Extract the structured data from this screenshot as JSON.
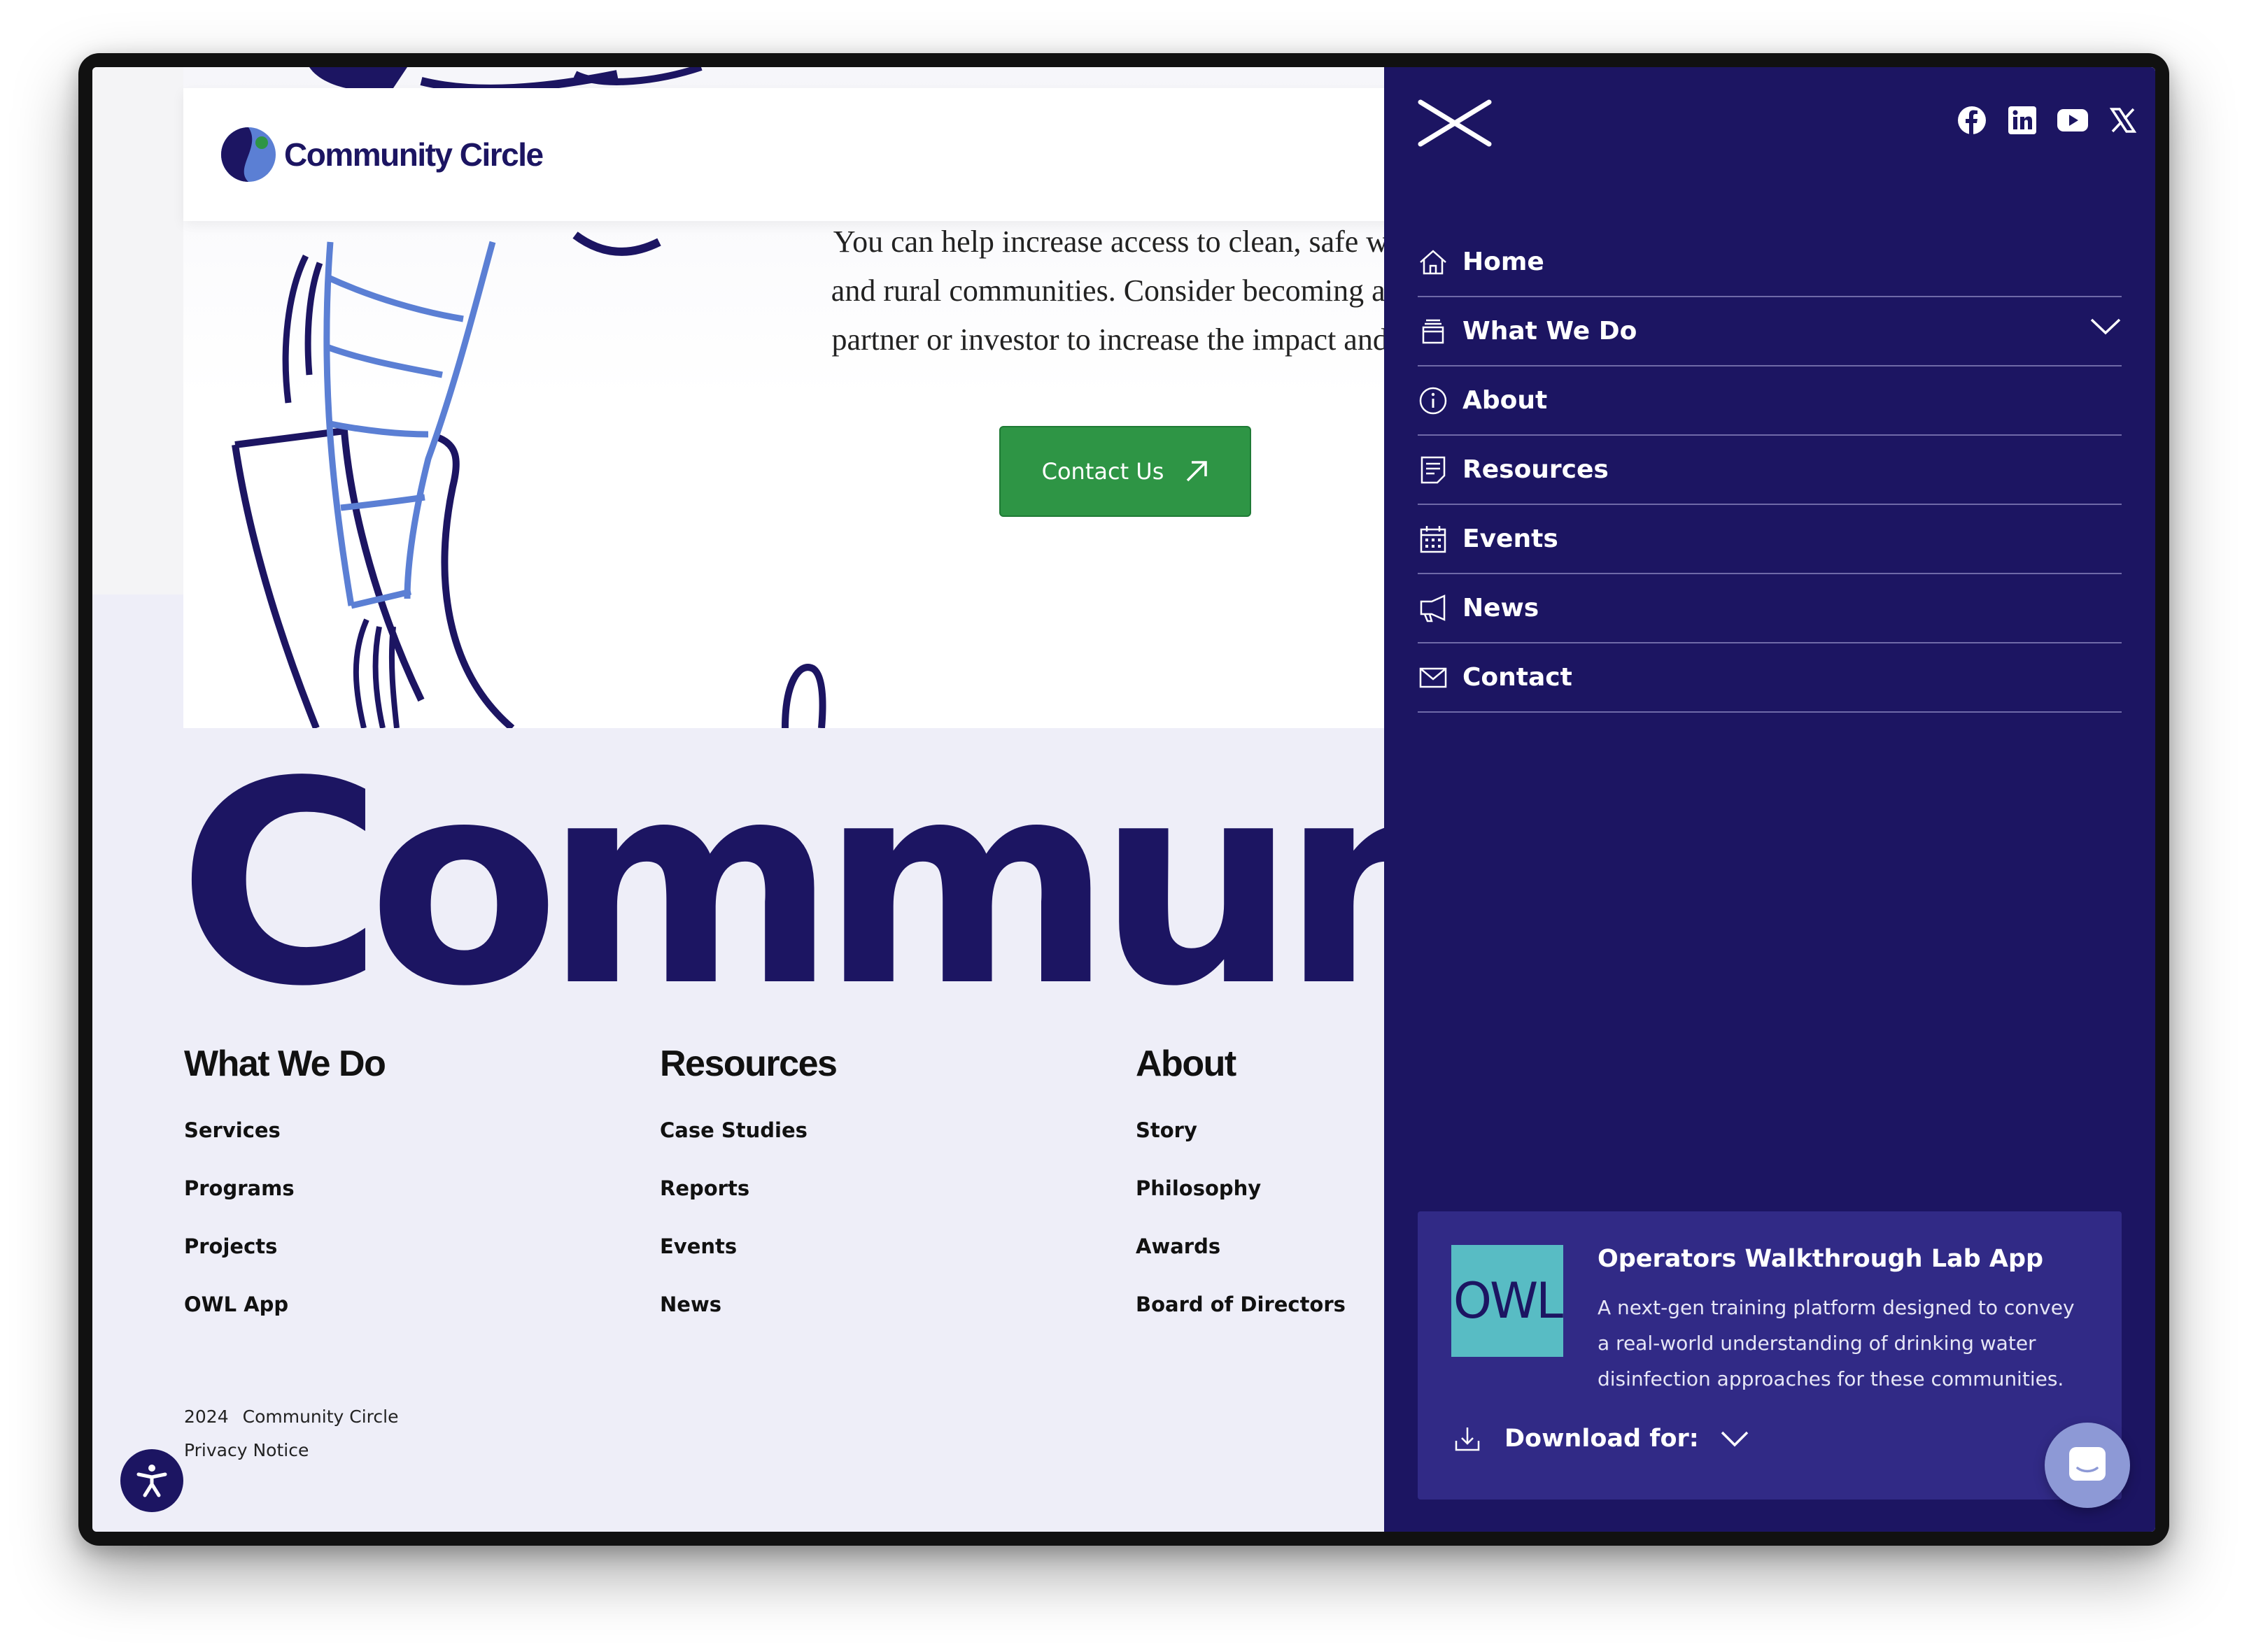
{
  "brand": {
    "name": "Community Circle",
    "navy": "#1c1562",
    "green": "#2e9545",
    "teal": "#58bcc4"
  },
  "hero": {
    "lines": [
      "You can help increase access to clean, safe water i",
      "and rural communities. Consider becoming a Com",
      "partner or investor to increase the impact and scop"
    ],
    "cta_label": "Contact Us",
    "cta_icon": "arrow-up-right-icon"
  },
  "big_word": "Community",
  "footer": {
    "columns": [
      {
        "heading": "What We Do",
        "links": [
          "Services",
          "Programs",
          "Projects",
          "OWL App"
        ]
      },
      {
        "heading": "Resources",
        "links": [
          "Case Studies",
          "Reports",
          "Events",
          "News"
        ]
      },
      {
        "heading": "About",
        "links": [
          "Story",
          "Philosophy",
          "Awards",
          "Board of Directors"
        ]
      }
    ],
    "year": "2024",
    "org": "Community Circle",
    "privacy": "Privacy Notice"
  },
  "drawer": {
    "close_icon": "close-icon",
    "socials": [
      "facebook-icon",
      "linkedin-icon",
      "youtube-icon",
      "x-icon"
    ],
    "nav": [
      {
        "label": "Home",
        "icon": "home-icon"
      },
      {
        "label": "What We Do",
        "icon": "stack-icon",
        "expandable": true
      },
      {
        "label": "About",
        "icon": "info-icon"
      },
      {
        "label": "Resources",
        "icon": "document-icon"
      },
      {
        "label": "Events",
        "icon": "calendar-icon"
      },
      {
        "label": "News",
        "icon": "megaphone-icon"
      },
      {
        "label": "Contact",
        "icon": "mail-icon"
      }
    ],
    "app_card": {
      "logo_text": "OWL",
      "title": "Operators Walkthrough Lab App",
      "description": "A next-gen training platform designed to convey a real-world understanding of drinking water disinfection approaches for these communities.",
      "download_label": "Download for:"
    }
  }
}
